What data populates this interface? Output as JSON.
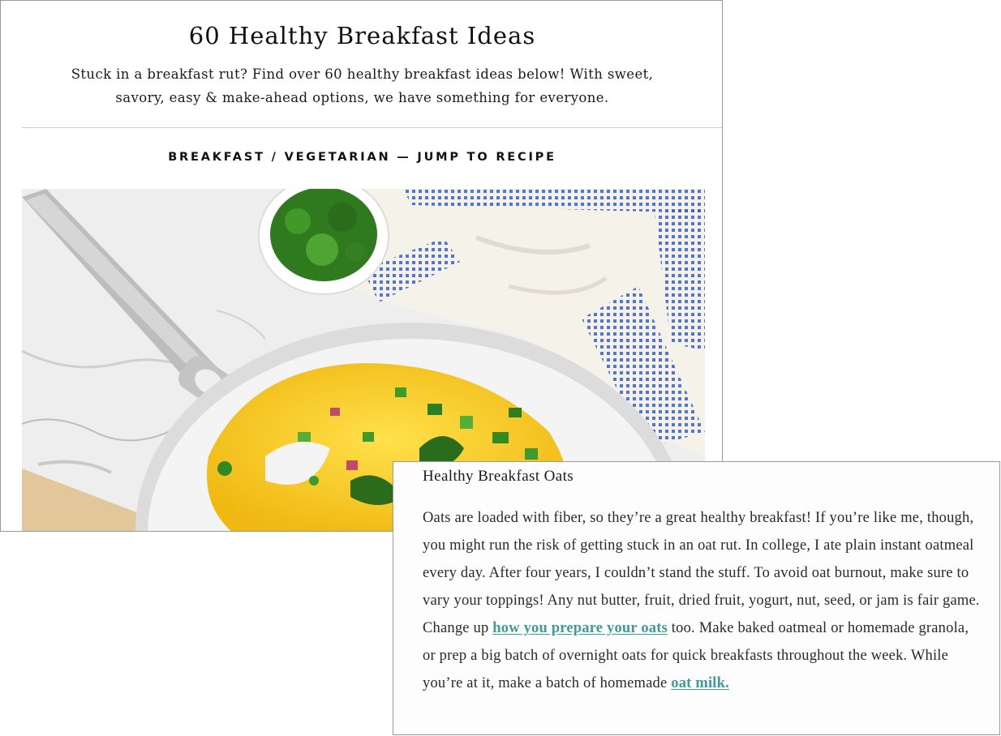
{
  "header": {
    "title": "60 Healthy Breakfast Ideas",
    "subtitle": "Stuck in a breakfast rut? Find over 60 healthy breakfast ideas below! With sweet, savory, easy & make-ahead options, we have something for everyone."
  },
  "categories": {
    "first": "BREAKFAST",
    "sep1": " / ",
    "second": "VEGETARIAN",
    "sep2": " — ",
    "jump": "JUMP TO RECIPE"
  },
  "hero_image": {
    "icon": "omelet-pan-photo"
  },
  "overlay": {
    "heading": "Healthy Breakfast Oats",
    "text_1": "Oats are loaded with fiber, so they’re a great healthy breakfast! If you’re like me, though, you might run the risk of getting stuck in an oat rut. In college, I ate plain instant oatmeal every day. After four years, I couldn’t stand the stuff. To avoid oat burnout, make sure to vary your toppings! Any nut butter, fruit, dried fruit, yogurt, nut, seed, or jam is fair game. Change up ",
    "link_1": "how you prepare your oats",
    "text_2": " too. Make baked oatmeal or homemade granola, or prep a big batch of overnight oats for quick breakfasts throughout the week. While you’re at it, make a batch of homemade ",
    "link_2": "oat milk."
  },
  "colors": {
    "link": "#3f9a98",
    "egg": "#f3c419",
    "towel_stripe": "#3a5fbf"
  }
}
